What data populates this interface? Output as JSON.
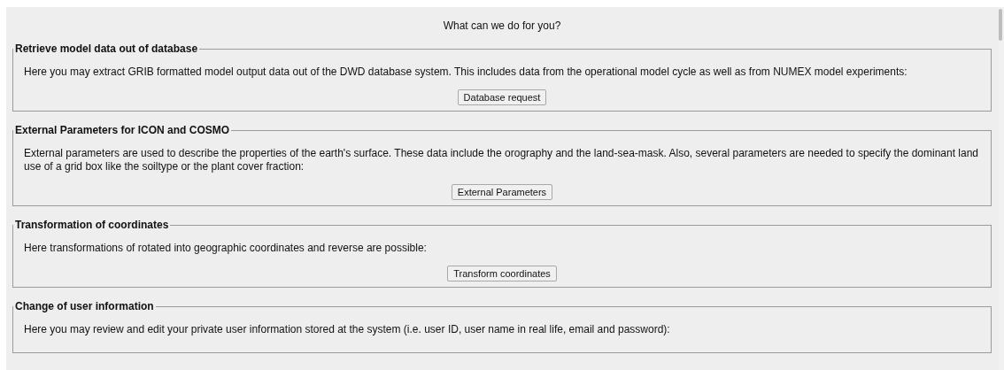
{
  "heading": "What can we do for you?",
  "sections": [
    {
      "title": "Retrieve model data out of database",
      "text": "Here you may extract GRIB formatted model output data out of the DWD database system. This includes data from the operational model cycle as well as from NUMEX model experiments:",
      "button": "Database request"
    },
    {
      "title": "External Parameters for ICON and COSMO",
      "text": "External parameters are used to describe the properties of the earth's surface. These data include the orography and the land-sea-mask. Also, several parameters are needed to specify the dominant land use of a grid box like the soiltype or the plant cover fraction:",
      "button": "External Parameters"
    },
    {
      "title": "Transformation of coordinates",
      "text": "Here transformations of rotated into geographic coordinates and reverse are possible:",
      "button": "Transform coordinates"
    },
    {
      "title": "Change of user information",
      "text": "Here you may review and edit your private user information stored at the system (i.e. user ID, user name in real life, email and password):"
    }
  ]
}
